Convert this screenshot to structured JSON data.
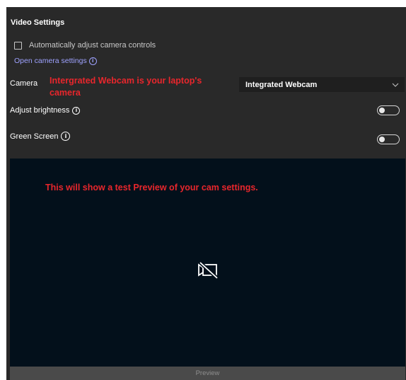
{
  "title": "Video Settings",
  "auto_adjust": {
    "label": "Automatically adjust camera controls",
    "checked": false
  },
  "open_camera_settings": {
    "label": "Open camera settings",
    "icon": "info-icon"
  },
  "camera": {
    "label": "Camera",
    "selected": "Integrated Webcam",
    "annotation": "Intergrated Webcam is your laptop's camera"
  },
  "brightness": {
    "label": "Adjust brightness",
    "icon": "info-icon",
    "enabled": false
  },
  "green_screen": {
    "label": "Green Screen",
    "icon": "info-icon",
    "enabled": false
  },
  "preview": {
    "annotation": "This will show a test Preview of your cam settings.",
    "icon": "camera-off-icon",
    "button_label": "Preview"
  }
}
